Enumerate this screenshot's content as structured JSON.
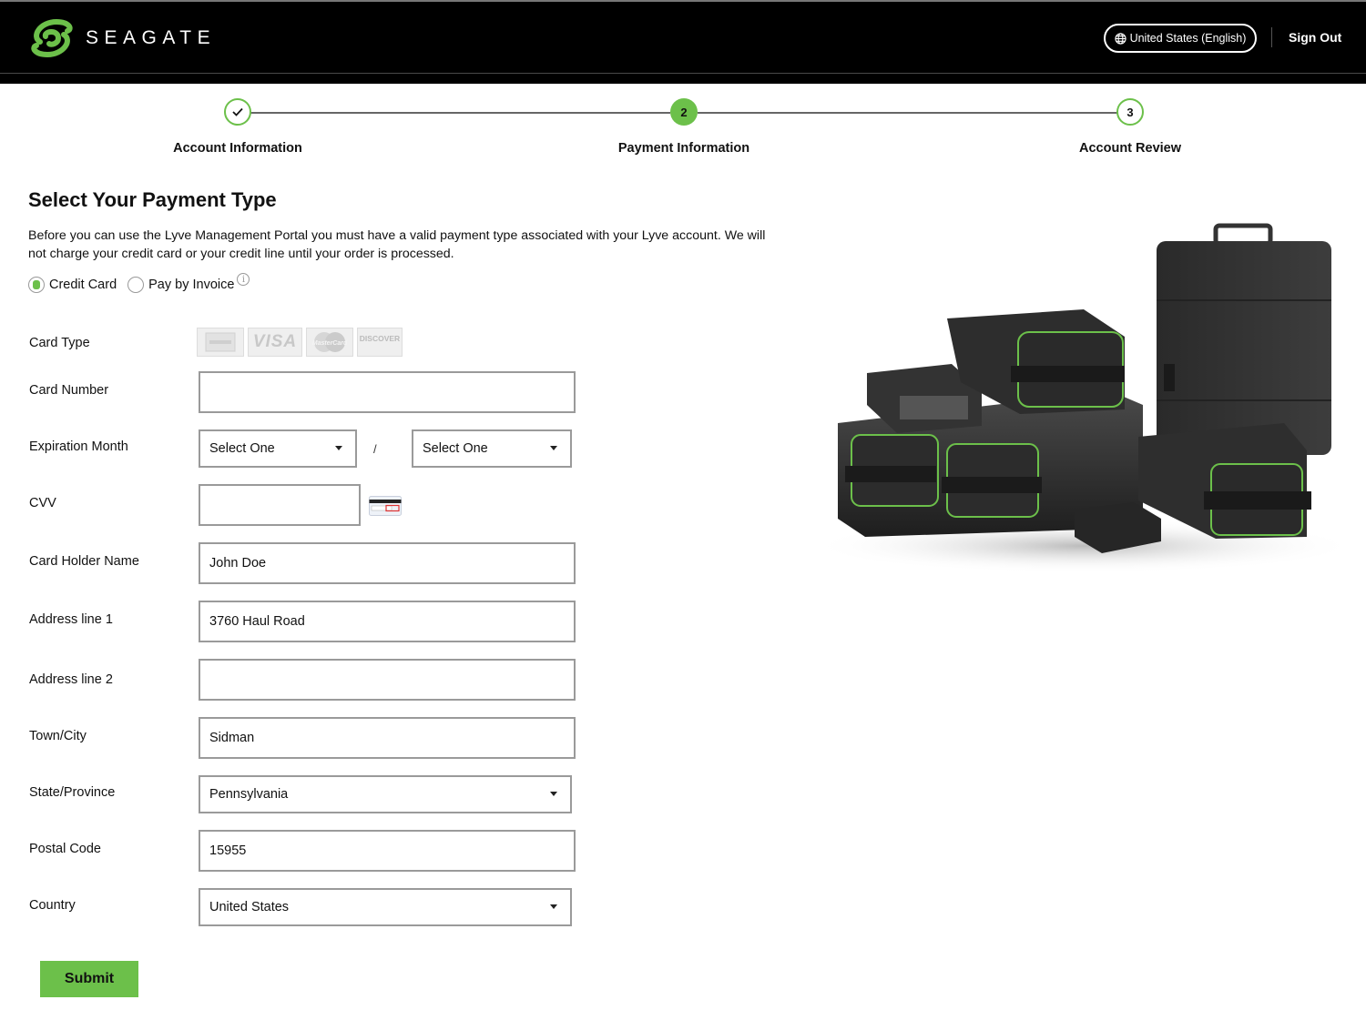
{
  "header": {
    "brand": "SEAGATE",
    "language_button": "United States (English)",
    "sign_out": "Sign Out"
  },
  "stepper": {
    "steps": [
      {
        "number": "✓",
        "label": "Account Information",
        "state": "done"
      },
      {
        "number": "2",
        "label": "Payment Information",
        "state": "active"
      },
      {
        "number": "3",
        "label": "Account Review",
        "state": "todo"
      }
    ]
  },
  "main": {
    "title": "Select Your Payment Type",
    "intro": "Before you can use the Lyve Management Portal you must have a valid payment type associated with your Lyve account. We will not charge your credit card or your credit line until your order is processed.",
    "payment_options": {
      "credit_card": "Credit Card",
      "pay_by_invoice": "Pay by Invoice",
      "selected": "Credit Card"
    }
  },
  "form": {
    "card_type": {
      "label": "Card Type",
      "cards": [
        "AMEX",
        "VISA",
        "MasterCard",
        "DISCOVER"
      ]
    },
    "card_number": {
      "label": "Card Number",
      "value": ""
    },
    "expiration": {
      "label": "Expiration Month",
      "month": "Select One",
      "separator": "/",
      "year": "Select One"
    },
    "cvv": {
      "label": "CVV",
      "value": ""
    },
    "card_holder": {
      "label": "Card Holder Name",
      "value": "John Doe"
    },
    "address1": {
      "label": "Address line 1",
      "value": "3760 Haul Road"
    },
    "address2": {
      "label": "Address line 2",
      "value": ""
    },
    "city": {
      "label": "Town/City",
      "value": "Sidman"
    },
    "state": {
      "label": "State/Province",
      "value": "Pennsylvania"
    },
    "postal": {
      "label": "Postal Code",
      "value": "15955"
    },
    "country": {
      "label": "Country",
      "value": "United States"
    },
    "submit": "Submit"
  },
  "colors": {
    "accent": "#6cc04a",
    "header_bg": "#000000"
  }
}
